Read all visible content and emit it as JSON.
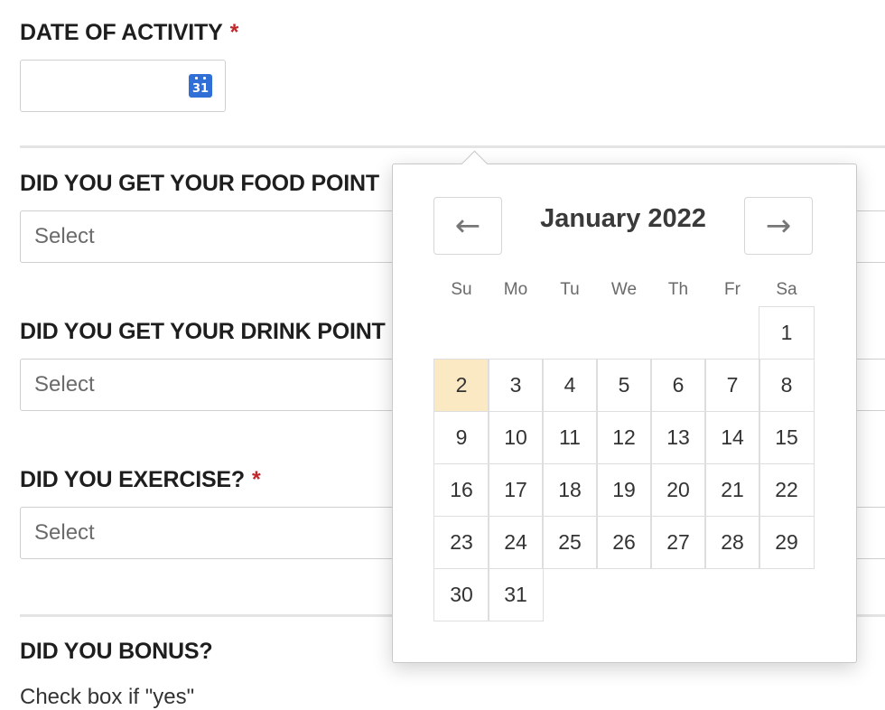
{
  "form": {
    "date_label": "DATE OF ACTIVITY",
    "required_mark": "*",
    "calendar_icon_text": "31",
    "food_label": "DID YOU GET YOUR FOOD POINT",
    "food_placeholder": "Select",
    "drink_label": "DID YOU GET YOUR DRINK POINT",
    "drink_placeholder": "Select",
    "exercise_label": "DID YOU EXERCISE?",
    "exercise_placeholder": "Select",
    "bonus_label": "DID YOU BONUS?",
    "bonus_helper": "Check box if \"yes\""
  },
  "datepicker": {
    "month_title": "January 2022",
    "prev_icon": "arrow-left-icon",
    "next_icon": "arrow-right-icon",
    "prev_glyph": "←",
    "next_glyph": "→",
    "weekdays": [
      "Su",
      "Mo",
      "Tu",
      "We",
      "Th",
      "Fr",
      "Sa"
    ],
    "weeks": [
      [
        "",
        "",
        "",
        "",
        "",
        "",
        "1"
      ],
      [
        "2",
        "3",
        "4",
        "5",
        "6",
        "7",
        "8"
      ],
      [
        "9",
        "10",
        "11",
        "12",
        "13",
        "14",
        "15"
      ],
      [
        "16",
        "17",
        "18",
        "19",
        "20",
        "21",
        "22"
      ],
      [
        "23",
        "24",
        "25",
        "26",
        "27",
        "28",
        "29"
      ],
      [
        "30",
        "31",
        "",
        "",
        "",
        "",
        ""
      ]
    ],
    "highlighted_day": "2",
    "highlight_color": "#fbe9c3"
  }
}
